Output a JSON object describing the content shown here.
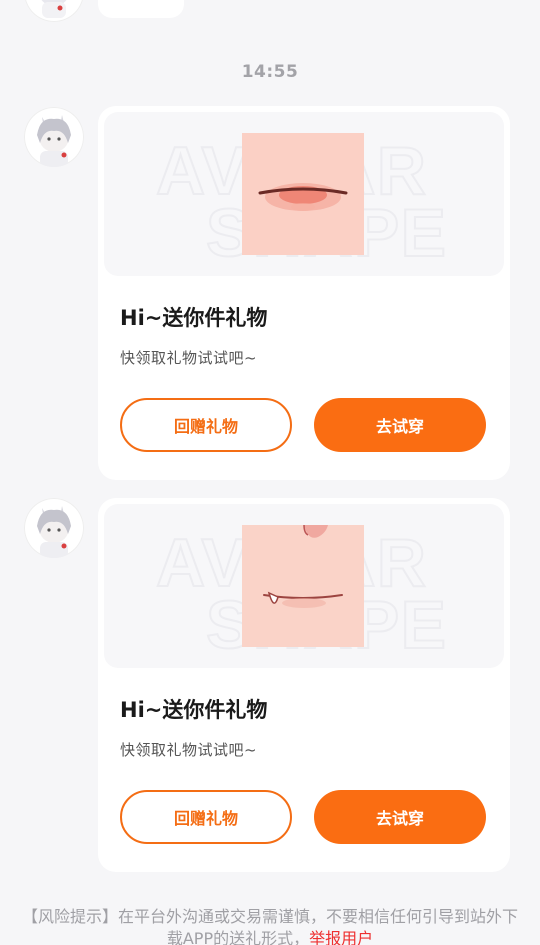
{
  "timestamp": "14:55",
  "messages": [
    {
      "title": "Hi~送你件礼物",
      "subtitle": "快领取礼物试试吧~",
      "return_gift_label": "回赠礼物",
      "try_on_label": "去试穿",
      "thumb_type": "lips-closed"
    },
    {
      "title": "Hi~送你件礼物",
      "subtitle": "快领取礼物试试吧~",
      "return_gift_label": "回赠礼物",
      "try_on_label": "去试穿",
      "thumb_type": "mouth-fang"
    }
  ],
  "risk_notice": {
    "text": "【风险提示】在平台外沟通或交易需谨慎，不要相信任何引导到站外下载APP的送礼形式，",
    "link": "举报用户"
  },
  "colors": {
    "accent": "#fa6d12",
    "background": "#f6f6f8",
    "link": "#ee3030"
  }
}
